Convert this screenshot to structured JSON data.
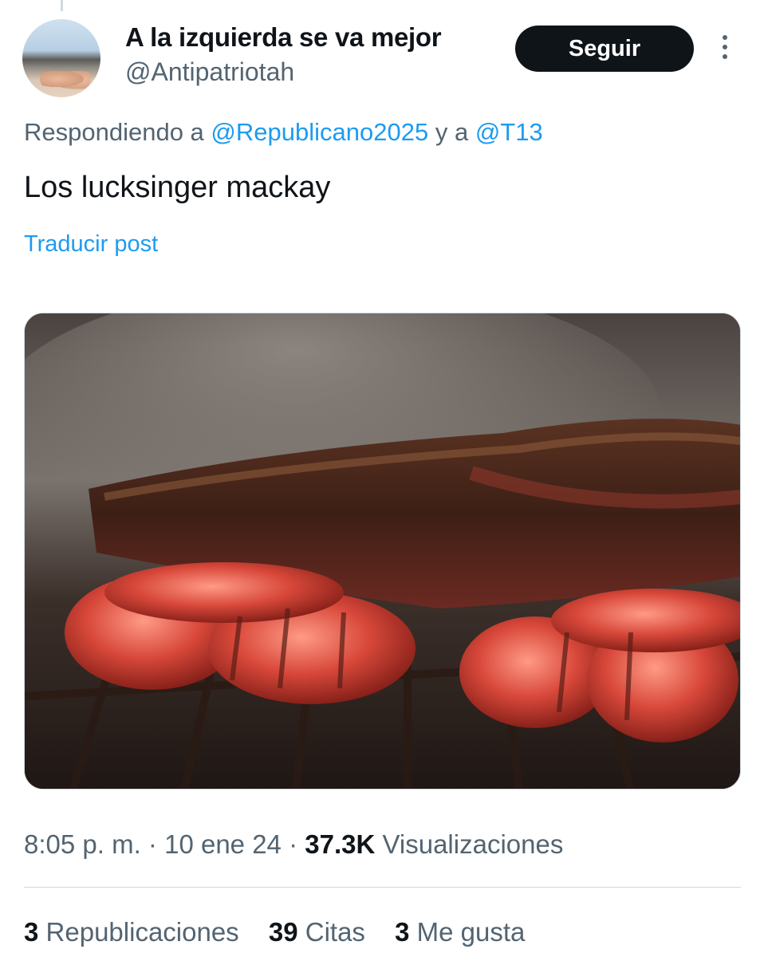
{
  "post": {
    "author": {
      "display_name": "A la izquierda se va mejor",
      "handle": "@Antipatriotah"
    },
    "follow_label": "Seguir",
    "replying": {
      "prefix": "Respondiendo a",
      "mention_1": "@Republicano2025",
      "joiner": "y a",
      "mention_2": "@T13"
    },
    "text": "Los lucksinger mackay",
    "translate_label": "Traducir post",
    "meta": {
      "time": "8:05 p. m.",
      "sep1": "·",
      "date": "10 ene 24",
      "sep2": "·",
      "views_count": "37.3K",
      "views_label": "Visualizaciones"
    },
    "stats": {
      "reposts_count": "3",
      "reposts_label": "Republicaciones",
      "quotes_count": "39",
      "quotes_label": "Citas",
      "likes_count": "3",
      "likes_label": "Me gusta"
    }
  },
  "colors": {
    "accent": "#1d9bf0",
    "text_primary": "#0f1419",
    "text_secondary": "#536471",
    "button_bg": "#0f1419"
  },
  "icons": {
    "more": "vertical-ellipsis-icon"
  }
}
